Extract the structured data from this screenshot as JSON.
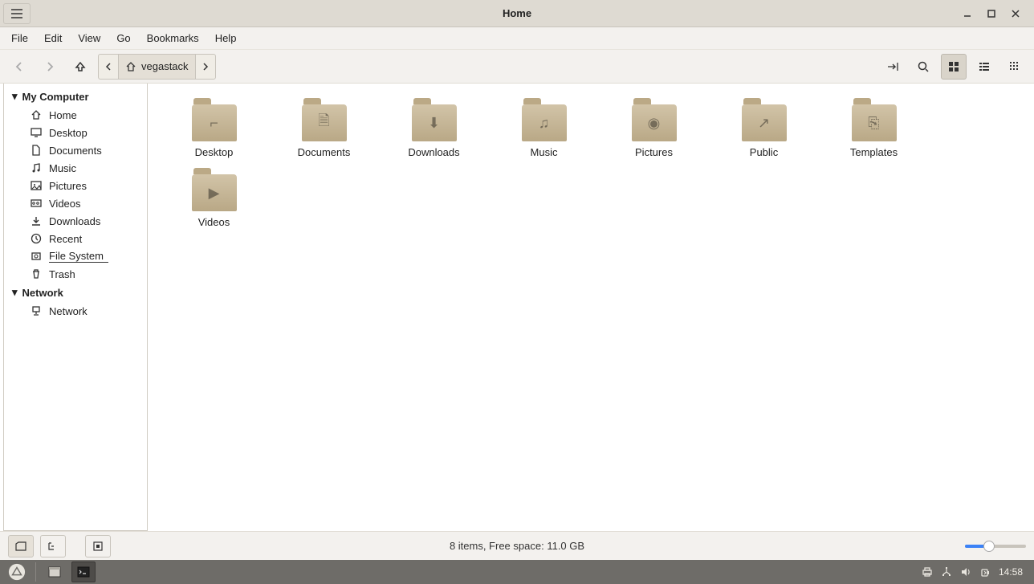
{
  "window": {
    "title": "Home"
  },
  "menu": [
    "File",
    "Edit",
    "View",
    "Go",
    "Bookmarks",
    "Help"
  ],
  "path": {
    "segment": "vegastack"
  },
  "sidebar": {
    "section1": "My Computer",
    "items1": [
      {
        "label": "Home",
        "icon": "home"
      },
      {
        "label": "Desktop",
        "icon": "desktop"
      },
      {
        "label": "Documents",
        "icon": "doc"
      },
      {
        "label": "Music",
        "icon": "music"
      },
      {
        "label": "Pictures",
        "icon": "pic"
      },
      {
        "label": "Videos",
        "icon": "video"
      },
      {
        "label": "Downloads",
        "icon": "download"
      },
      {
        "label": "Recent",
        "icon": "recent"
      },
      {
        "label": "File System",
        "icon": "fs",
        "activefs": true
      },
      {
        "label": "Trash",
        "icon": "trash"
      }
    ],
    "section2": "Network",
    "items2": [
      {
        "label": "Network",
        "icon": "network"
      }
    ]
  },
  "folders": [
    {
      "label": "Desktop",
      "glyph": "⌐"
    },
    {
      "label": "Documents",
      "glyph": "🗎"
    },
    {
      "label": "Downloads",
      "glyph": "⬇"
    },
    {
      "label": "Music",
      "glyph": "♫"
    },
    {
      "label": "Pictures",
      "glyph": "◉"
    },
    {
      "label": "Public",
      "glyph": "↗"
    },
    {
      "label": "Templates",
      "glyph": "⎘"
    },
    {
      "label": "Videos",
      "glyph": "▶"
    }
  ],
  "status": {
    "text": "8 items, Free space: 11.0 GB"
  },
  "taskbar": {
    "time": "14:58"
  }
}
